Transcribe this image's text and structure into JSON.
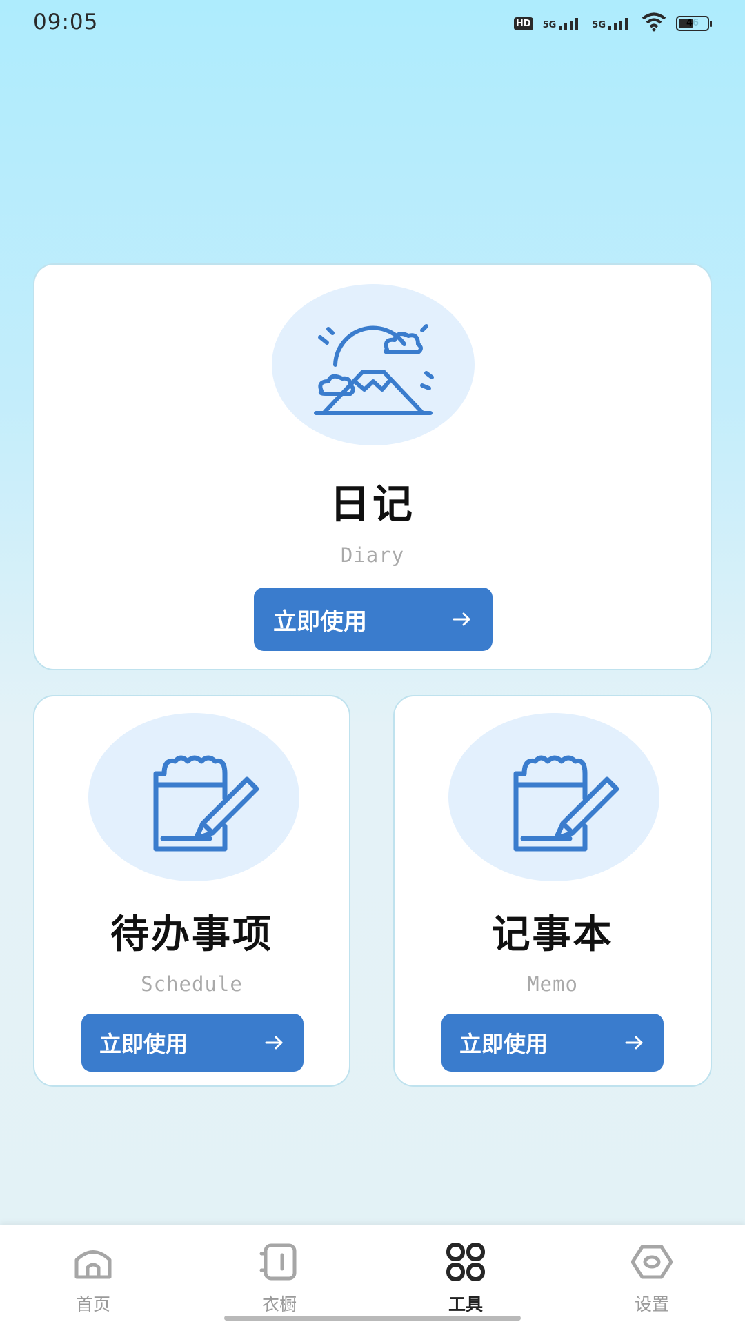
{
  "status_bar": {
    "time": "09:05",
    "battery": "46",
    "network_1": "5G",
    "network_2": "5G",
    "hd_label": "HD"
  },
  "cards": {
    "diary": {
      "title": "日记",
      "subtitle": "Diary",
      "button_label": "立即使用",
      "icon": "mountain-sun-icon"
    },
    "schedule": {
      "title": "待办事项",
      "subtitle": "Schedule",
      "button_label": "立即使用",
      "icon": "notepad-pencil-icon"
    },
    "memo": {
      "title": "记事本",
      "subtitle": "Memo",
      "button_label": "立即使用",
      "icon": "notepad-pencil-icon"
    }
  },
  "bottom_nav": {
    "items": [
      {
        "label": "首页",
        "icon": "home-icon",
        "active": false
      },
      {
        "label": "衣橱",
        "icon": "wardrobe-icon",
        "active": false
      },
      {
        "label": "工具",
        "icon": "tools-grid-icon",
        "active": true
      },
      {
        "label": "设置",
        "icon": "settings-icon",
        "active": false
      }
    ]
  },
  "colors": {
    "accent": "#3a7ccd",
    "icon_circle": "#e3f0fd",
    "card_border": "#bfe2ee"
  }
}
